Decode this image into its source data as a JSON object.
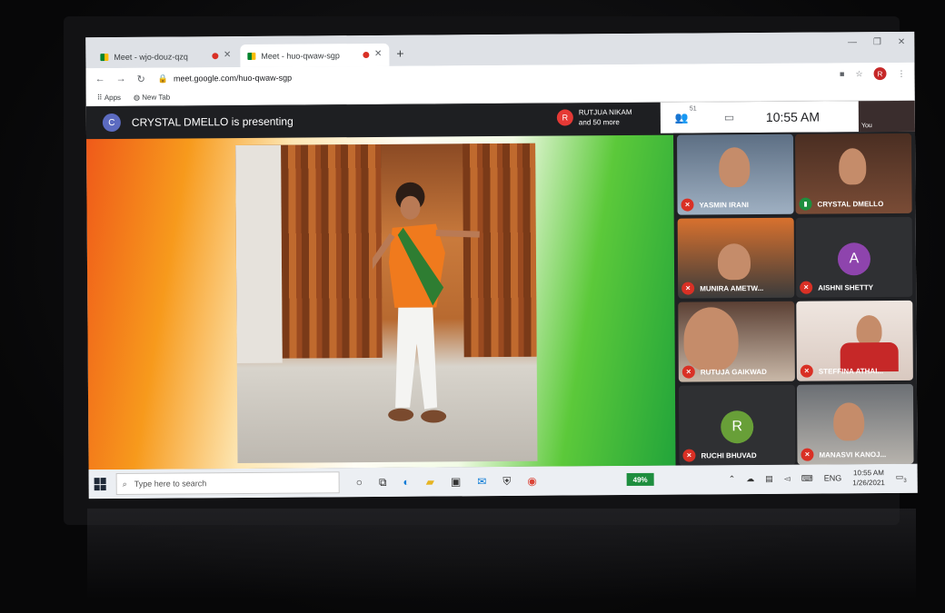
{
  "browser": {
    "tabs": [
      {
        "label": "Meet - wjo-douz-qzq"
      },
      {
        "label": "Meet - huo-qwaw-sgp"
      }
    ],
    "new_tab_symbol": "+",
    "window_controls": [
      "—",
      "❐",
      "✕"
    ],
    "url": "meet.google.com/huo-qwaw-sgp",
    "profile_initial": "R",
    "bookmarks": [
      {
        "label": "Apps"
      },
      {
        "label": "New Tab"
      }
    ]
  },
  "meet": {
    "presenter_initial": "C",
    "presenter_text": "CRYSTAL DMELLO is presenting",
    "chip_initial": "R",
    "chip_name": "RUTJUA NIKAM",
    "chip_more": "and 50 more",
    "people_count": "51",
    "clock": "10:55 AM",
    "self_label": "You",
    "participants": [
      {
        "name": "YASMIN IRANI",
        "initial": ""
      },
      {
        "name": "CRYSTAL DMELLO",
        "initial": ""
      },
      {
        "name": "MUNIRA AMETW...",
        "initial": ""
      },
      {
        "name": "AISHNI SHETTY",
        "initial": "A",
        "color": "#8e44ad"
      },
      {
        "name": "RUTUJA GAIKWAD",
        "initial": ""
      },
      {
        "name": "STEFFINA ATHAI...",
        "initial": ""
      },
      {
        "name": "RUCHI BHUVAD",
        "initial": "R",
        "color": "#689f38"
      },
      {
        "name": "MANASVI KANOJ...",
        "initial": ""
      }
    ]
  },
  "taskbar": {
    "search_placeholder": "Type here to search",
    "battery": "49%",
    "lang": "ENG",
    "time": "10:55 AM",
    "date": "1/26/2021",
    "notif_count": "3"
  }
}
